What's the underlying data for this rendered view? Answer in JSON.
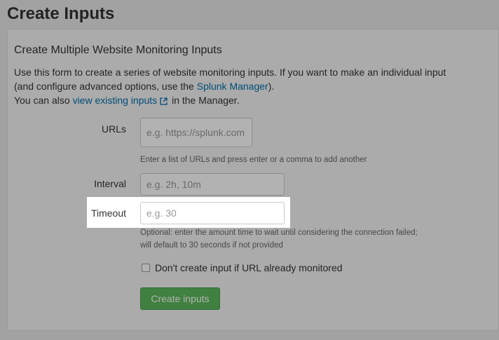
{
  "page": {
    "title": "Create Inputs"
  },
  "form": {
    "section_title": "Create Multiple Website Monitoring Inputs",
    "intro_line1": "Use this form to create a series of website monitoring inputs. If you want to make an individual input (and configure advanced options, use the ",
    "manager_link": "Splunk Manager",
    "intro_line1_end": ").",
    "intro_line2_start": "You can also ",
    "existing_link": "view existing inputs",
    "intro_line2_end": " in the Manager.",
    "urls": {
      "label": "URLs",
      "placeholder": "e.g. https://splunk.com",
      "help": "Enter a list of URLs and press enter or a comma to add another"
    },
    "interval": {
      "label": "Interval",
      "placeholder": "e.g. 2h, 10m"
    },
    "timeout": {
      "label": "Timeout",
      "placeholder": "e.g. 30",
      "help_line1": "Optional: enter the amount time to wait until considering the connection failed;",
      "help_line2": "will default to 30 seconds if not provided"
    },
    "dont_create_checkbox": {
      "label": "Don't create input if URL already monitored",
      "checked": false
    },
    "submit_label": "Create inputs"
  },
  "colors": {
    "link": "#006eaa",
    "button": "#5cb85c",
    "overlay": "rgba(0,0,0,0.3)"
  },
  "icons": {
    "external": "external-link-icon"
  }
}
